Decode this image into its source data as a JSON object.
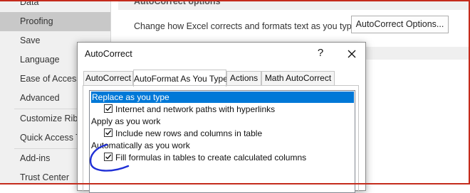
{
  "sidebar": {
    "items": [
      {
        "label": "Data"
      },
      {
        "label": "Proofing"
      },
      {
        "label": "Save"
      },
      {
        "label": "Language"
      },
      {
        "label": "Ease of Access"
      },
      {
        "label": "Advanced"
      },
      {
        "label": "Customize Ribbon"
      },
      {
        "label": "Quick Access Toolbar"
      },
      {
        "label": "Add-ins"
      },
      {
        "label": "Trust Center"
      }
    ],
    "active_index": 1
  },
  "main": {
    "section_title": "AutoCorrect options",
    "description": "Change how Excel corrects and formats text as you type:",
    "autocorrect_button": "AutoCorrect Options..."
  },
  "dialog": {
    "title": "AutoCorrect",
    "help_glyph": "?",
    "tabs": [
      {
        "label": "AutoCorrect"
      },
      {
        "label": "AutoFormat As You Type"
      },
      {
        "label": "Actions"
      },
      {
        "label": "Math AutoCorrect"
      }
    ],
    "active_tab": 1,
    "list": {
      "group_replace": "Replace as you type",
      "option_hyperlinks": {
        "label": "Internet and network paths with hyperlinks",
        "checked": true
      },
      "group_apply": "Apply as you work",
      "option_rows": {
        "label": "Include new rows and columns in table",
        "checked": true
      },
      "group_auto": "Automatically as you work",
      "option_formulas": {
        "label": "Fill formulas in tables to create calculated columns",
        "checked": true
      }
    }
  },
  "colors": {
    "selection": "#0078d7",
    "annotation_ink": "#1f2fd6",
    "frame": "#c42b1c"
  }
}
